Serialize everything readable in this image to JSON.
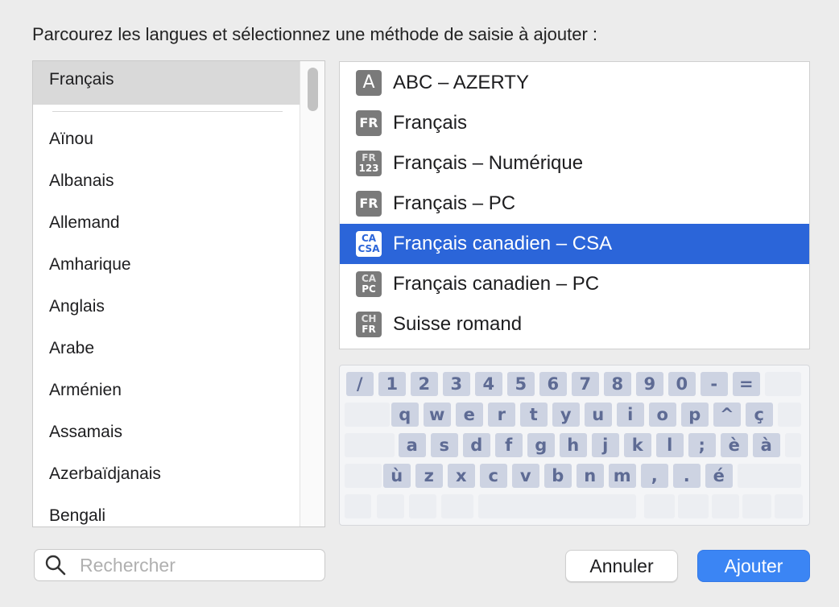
{
  "prompt": "Parcourez les langues et sélectionnez une méthode de saisie à ajouter :",
  "languages": {
    "selected": "Français",
    "items": [
      "Aïnou",
      "Albanais",
      "Allemand",
      "Amharique",
      "Anglais",
      "Arabe",
      "Arménien",
      "Assamais",
      "Azerbaïdjanais",
      "Bengali"
    ]
  },
  "methods": [
    {
      "label": "ABC – AZERTY",
      "icon": "letter-a-icon",
      "badge1": "A",
      "badge2": ""
    },
    {
      "label": "Français",
      "icon": "fr-icon",
      "badge1": "FR",
      "badge2": ""
    },
    {
      "label": "Français – Numérique",
      "icon": "fr-123-icon",
      "badge1": "FR",
      "badge2": "123"
    },
    {
      "label": "Français – PC",
      "icon": "fr-icon",
      "badge1": "FR",
      "badge2": ""
    },
    {
      "label": "Français canadien – CSA",
      "icon": "ca-csa-icon",
      "badge1": "CA",
      "badge2": "CSA"
    },
    {
      "label": "Français canadien – PC",
      "icon": "ca-pc-icon",
      "badge1": "CA",
      "badge2": "PC"
    },
    {
      "label": "Suisse romand",
      "icon": "ch-fr-icon",
      "badge1": "CH",
      "badge2": "FR"
    }
  ],
  "keyboard": {
    "row1": [
      "/",
      "1",
      "2",
      "3",
      "4",
      "5",
      "6",
      "7",
      "8",
      "9",
      "0",
      "-",
      "="
    ],
    "row2": [
      "q",
      "w",
      "e",
      "r",
      "t",
      "y",
      "u",
      "i",
      "o",
      "p",
      "^",
      "ç"
    ],
    "row3": [
      "a",
      "s",
      "d",
      "f",
      "g",
      "h",
      "j",
      "k",
      "l",
      ";",
      "è",
      "à"
    ],
    "row4": [
      "ù",
      "z",
      "x",
      "c",
      "v",
      "b",
      "n",
      "m",
      ",",
      ".",
      "é"
    ]
  },
  "search": {
    "placeholder": "Rechercher"
  },
  "buttons": {
    "cancel": "Annuler",
    "add": "Ajouter"
  },
  "colors": {
    "selection": "#2b65d9",
    "primary_button": "#3b85f4",
    "key_text": "#5e6b94"
  }
}
